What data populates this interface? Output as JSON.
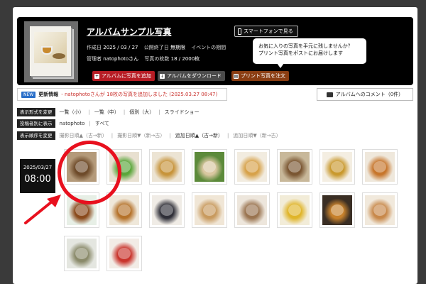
{
  "album": {
    "title": "アルバムサンプル写真",
    "smartphone_button": "スマートフォンで見る",
    "meta": {
      "created_label": "作成日",
      "created_value": "2025 / 03 / 27",
      "deadline_label": "公開終了日",
      "deadline_value": "無期限",
      "event_label": "イベントの期間",
      "admin_label": "管理者",
      "admin_value": "natophotoさん",
      "count_label": "写真の枚数",
      "count_value": "18 / 2000枚"
    },
    "bubble": [
      "お気に入りの写真を手元に残しませんか？",
      "プリント写真をポストにお届けします"
    ],
    "buttons": {
      "add": "アルバムに写真を追加",
      "download": "アルバムをダウンロード",
      "order": "プリント写真を注文"
    }
  },
  "news": {
    "badge": "NEW",
    "label": "更新情報",
    "message": "- natophotoさんが 18枚の写真を追加しました (2025.03.27 08:47)"
  },
  "comment_button": "アルバムへのコメント（0件）",
  "filters": {
    "display": {
      "tag": "表示形式を変更",
      "options": [
        "一覧（小）",
        "一覧（中）",
        "個別（大）",
        "スライドショー"
      ]
    },
    "poster": {
      "tag": "投稿者別に表示",
      "options": [
        "natophoto",
        "すべて"
      ]
    },
    "order": {
      "tag": "表示順序を変更",
      "options": [
        "撮影日順▲（古→新）",
        "撮影日順▼（新→古）",
        "追加日順▲（古→新）",
        "追加日順▼（新→古）"
      ]
    }
  },
  "group": {
    "date": "2025/03/27",
    "time": "08:00"
  },
  "photos": [
    {
      "c1": "#b49a7a",
      "c2": "#6e4b2a"
    },
    {
      "c1": "#e8e0d0",
      "c2": "#5aa63a"
    },
    {
      "c1": "#ece4d4",
      "c2": "#c7943b"
    },
    {
      "c1": "#5c8a3a",
      "c2": "#d9c7a0"
    },
    {
      "c1": "#f2ece0",
      "c2": "#d7a24a"
    },
    {
      "c1": "#c8b89a",
      "c2": "#7a5632"
    },
    {
      "c1": "#f4eee2",
      "c2": "#c9992e"
    },
    {
      "c1": "#efe8dc",
      "c2": "#c7762c"
    },
    {
      "c1": "#e7efe6",
      "c2": "#8a4a1c"
    },
    {
      "c1": "#efe8da",
      "c2": "#b5722a"
    },
    {
      "c1": "#f0ece6",
      "c2": "#2f2f38"
    },
    {
      "c1": "#f0e6d6",
      "c2": "#c89a5e"
    },
    {
      "c1": "#ede6dc",
      "c2": "#9a7450"
    },
    {
      "c1": "#f2ecd8",
      "c2": "#e0b52a"
    },
    {
      "c1": "#3a2e24",
      "c2": "#c7812c"
    },
    {
      "c1": "#f1e9dc",
      "c2": "#c8884a"
    },
    {
      "c1": "#e4e6e0",
      "c2": "#8a8a6a"
    },
    {
      "c1": "#f2ece6",
      "c2": "#c9342c"
    },
    {
      "c1": "#f5f2ec",
      "c2": "#e6c21c"
    }
  ]
}
